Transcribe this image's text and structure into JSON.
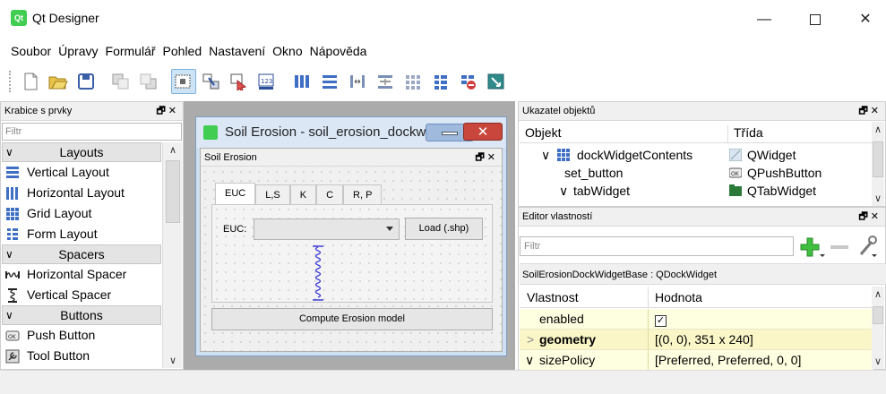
{
  "window": {
    "title": "Qt Designer",
    "app_icon_text": "Qt",
    "minimize": "—",
    "close": "✕"
  },
  "menu": [
    "Soubor",
    "Úpravy",
    "Formulář",
    "Pohled",
    "Nastavení",
    "Okno",
    "Nápověda"
  ],
  "toolbar": {
    "icons": [
      "new-file-icon",
      "open-folder-icon",
      "save-icon",
      "send-to-back-icon",
      "bring-to-front-icon",
      "edit-widgets-icon",
      "edit-signals-slots-icon",
      "edit-buddies-icon",
      "edit-tab-order-icon",
      "lay-out-horizontally-icon",
      "lay-out-vertically-icon",
      "lay-out-horizontal-splitter-icon",
      "lay-out-vertical-splitter-icon",
      "lay-out-grid-icon",
      "lay-out-form-icon",
      "break-layout-icon",
      "adjust-size-icon"
    ]
  },
  "widget_box": {
    "title": "Krabice s prvky",
    "filter_placeholder": "Filtr",
    "categories": [
      {
        "label": "Layouts",
        "items": [
          "Vertical Layout",
          "Horizontal Layout",
          "Grid Layout",
          "Form Layout"
        ]
      },
      {
        "label": "Spacers",
        "items": [
          "Horizontal Spacer",
          "Vertical Spacer"
        ]
      },
      {
        "label": "Buttons",
        "items": [
          "Push Button",
          "Tool Button"
        ]
      }
    ]
  },
  "form_window": {
    "title": "Soil Erosion - soil_erosion_dockwi",
    "dock_title": "Soil Erosion",
    "tabs": [
      "EUC",
      "L,S",
      "K",
      "C",
      "R, P"
    ],
    "active_tab": "EUC",
    "euc_label": "EUC:",
    "combo_value": "",
    "load_button": "Load (.shp)",
    "compute_button": "Compute Erosion model"
  },
  "object_inspector": {
    "title": "Ukazatel objektů",
    "col_object": "Objekt",
    "col_class": "Třída",
    "rows": [
      {
        "name": "dockWidgetContents",
        "class": "QWidget",
        "expand": "∨"
      },
      {
        "name": "set_button",
        "class": "QPushButton",
        "expand": ""
      },
      {
        "name": "tabWidget",
        "class": "QTabWidget",
        "expand": "∨"
      }
    ]
  },
  "property_editor": {
    "title": "Editor vlastností",
    "filter_placeholder": "Filtr",
    "class_line": "SoilErosionDockWidgetBase : QDockWidget",
    "col_property": "Vlastnost",
    "col_value": "Hodnota",
    "rows": [
      {
        "name": "enabled",
        "value": "✓",
        "expand": ""
      },
      {
        "name": "geometry",
        "value": "[(0, 0), 351 x 240]",
        "expand": ">"
      },
      {
        "name": "sizePolicy",
        "value": "[Preferred, Preferred, 0, 0]",
        "expand": "∨"
      }
    ]
  },
  "colors": {
    "accent": "#41cd52",
    "selection": "#cde4f7",
    "property_row": "#fefee0",
    "mdi_bg": "#ababab",
    "close_red": "#c9463d"
  }
}
